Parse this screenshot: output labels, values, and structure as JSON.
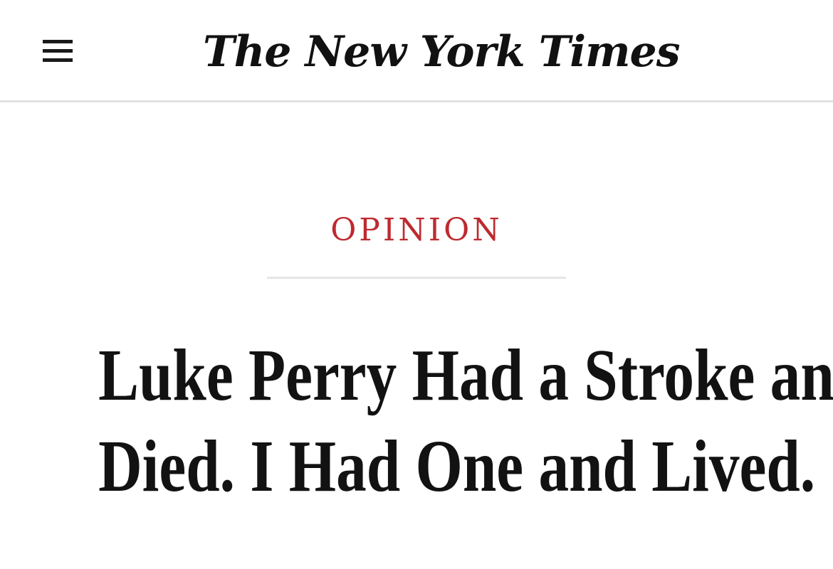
{
  "header": {
    "menu_icon": "hamburger-menu-icon",
    "masthead": "The New York Times"
  },
  "article": {
    "section": "OPINION",
    "headline_lines": [
      "Luke Perry Had a Stroke and",
      "Died. I Had One and Lived."
    ]
  },
  "colors": {
    "section_accent": "#be2a2f",
    "text": "#121212",
    "divider": "#e2e2e2"
  }
}
